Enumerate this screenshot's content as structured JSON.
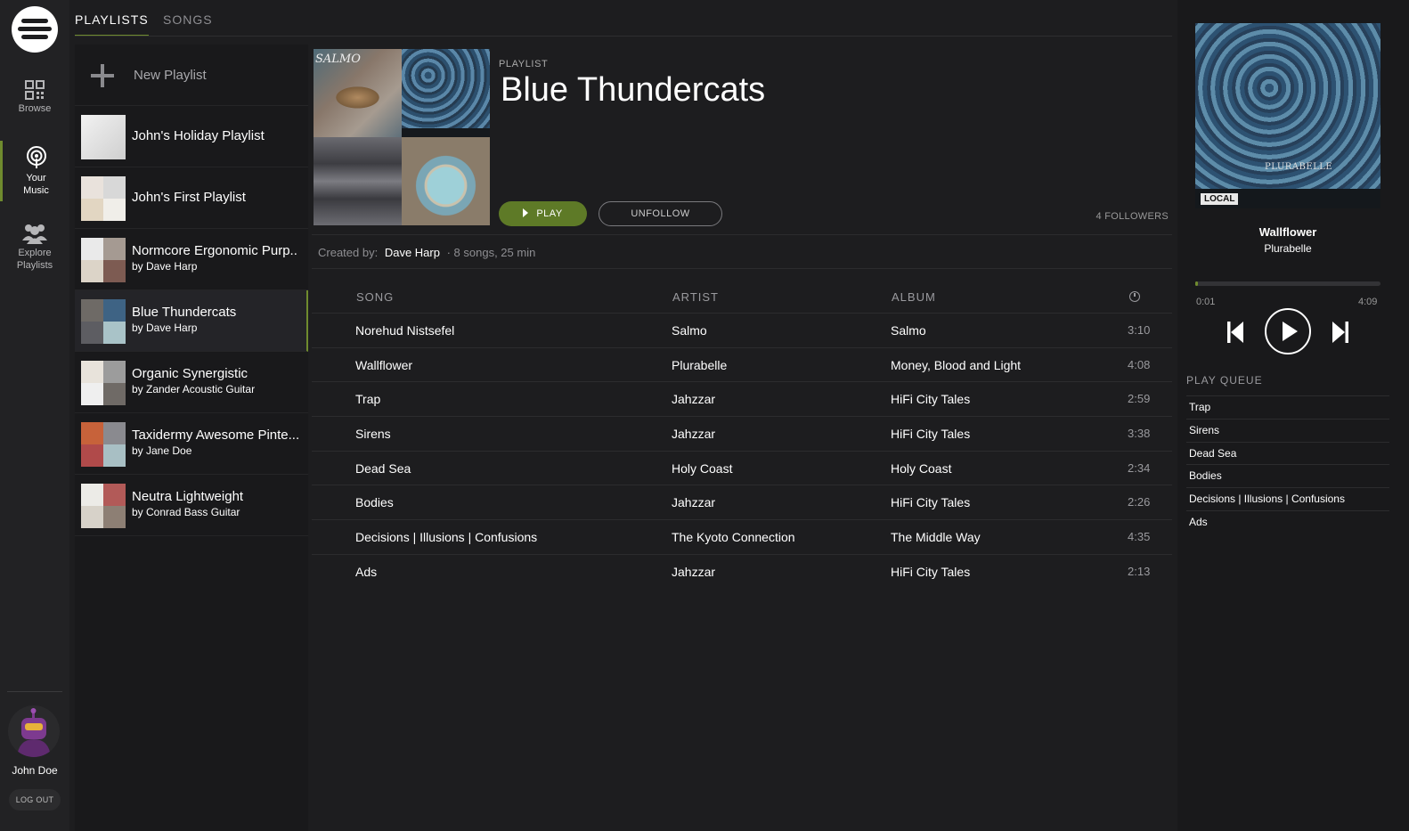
{
  "nav": {
    "browse": "Browse",
    "your_music_1": "Your",
    "your_music_2": "Music",
    "explore_1": "Explore",
    "explore_2": "Playlists"
  },
  "user": {
    "name": "John Doe",
    "logout": "LOG OUT"
  },
  "tabs": [
    {
      "label": "PLAYLISTS",
      "active": true
    },
    {
      "label": "SONGS",
      "active": false
    }
  ],
  "playlists": {
    "new_label": "New Playlist",
    "items": [
      {
        "name": "John's Holiday Playlist",
        "by": ""
      },
      {
        "name": "John's First Playlist",
        "by": ""
      },
      {
        "name": "Normcore Ergonomic Purp..",
        "by": "by Dave Harp"
      },
      {
        "name": "Blue Thundercats",
        "by": "by Dave Harp",
        "active": true
      },
      {
        "name": "Organic Synergistic",
        "by": "by Zander Acoustic Guitar"
      },
      {
        "name": "Taxidermy Awesome Pinte...",
        "by": "by Jane Doe"
      },
      {
        "name": "Neutra Lightweight",
        "by": "by Conrad Bass Guitar"
      }
    ]
  },
  "playlist": {
    "label": "PLAYLIST",
    "title": "Blue Thundercats",
    "play": "PLAY",
    "unfollow": "UNFOLLOW",
    "followers": "4 FOLLOWERS",
    "created_label": "Created by:",
    "creator": "Dave Harp",
    "summary": "· 8 songs, 25 min",
    "cover_text": "SALMO"
  },
  "table": {
    "headers": {
      "song": "SONG",
      "artist": "ARTIST",
      "album": "ALBUM"
    },
    "rows": [
      {
        "song": "Norehud Nistsefel",
        "artist": "Salmo",
        "album": "Salmo",
        "time": "3:10"
      },
      {
        "song": "Wallflower",
        "artist": "Plurabelle",
        "album": "Money, Blood and Light",
        "time": "4:08"
      },
      {
        "song": "Trap",
        "artist": "Jahzzar",
        "album": "HiFi City Tales",
        "time": "2:59"
      },
      {
        "song": "Sirens",
        "artist": "Jahzzar",
        "album": "HiFi City Tales",
        "time": "3:38"
      },
      {
        "song": "Dead Sea",
        "artist": "Holy Coast",
        "album": "Holy Coast",
        "time": "2:34"
      },
      {
        "song": "Bodies",
        "artist": "Jahzzar",
        "album": "HiFi City Tales",
        "time": "2:26"
      },
      {
        "song": "Decisions | Illusions | Confusions",
        "artist": "The Kyoto Connection",
        "album": "The Middle Way",
        "time": "4:35"
      },
      {
        "song": "Ads",
        "artist": "Jahzzar",
        "album": "HiFi City Tales",
        "time": "2:13"
      }
    ]
  },
  "player": {
    "title": "Wallflower",
    "artist": "Plurabelle",
    "current": "0:01",
    "total": "4:09",
    "progress_fraction": 0.004,
    "art_text": "PLURABELLE",
    "art_badge": "LOCAL",
    "queue_label": "PLAY QUEUE",
    "queue": [
      "Trap",
      "Sirens",
      "Dead Sea",
      "Bodies",
      "Decisions | Illusions | Confusions",
      "Ads"
    ]
  },
  "colors": {
    "accent": "#6f8b2e",
    "background": "#1d1d1f",
    "panel": "#19191b"
  }
}
